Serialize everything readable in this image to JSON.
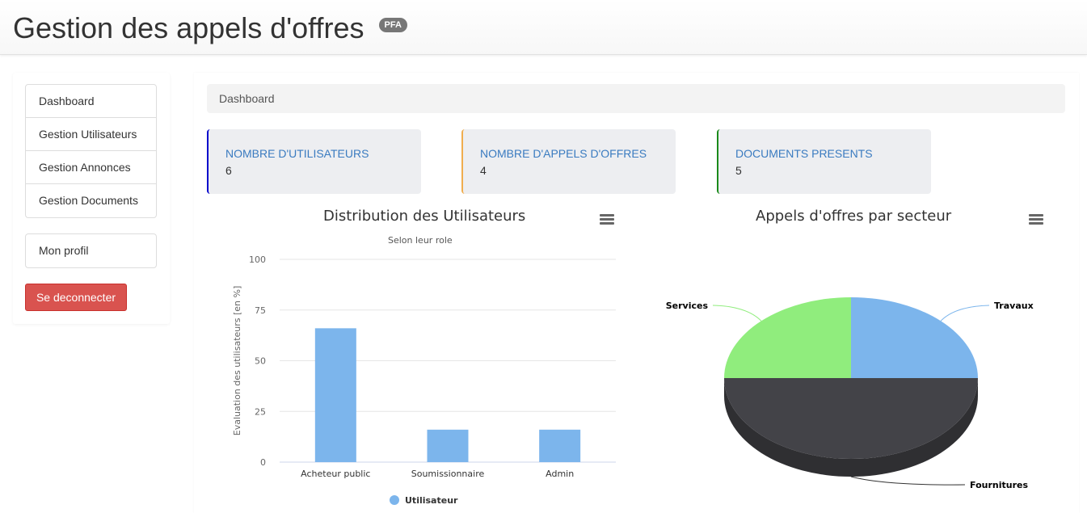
{
  "header": {
    "title": "Gestion des appels d'offres",
    "badge": "PFA"
  },
  "sidebar": {
    "items": [
      {
        "label": "Dashboard"
      },
      {
        "label": "Gestion Utilisateurs"
      },
      {
        "label": "Gestion Annonces"
      },
      {
        "label": "Gestion Documents"
      }
    ],
    "profile": "Mon profil",
    "logout": "Se deconnecter"
  },
  "breadcrumb": {
    "current": "Dashboard"
  },
  "stats": [
    {
      "label": "NOMBRE D'UTILISATEURS",
      "value": "6",
      "accent": "#0000cc"
    },
    {
      "label": "NOMBRE D'APPELS D'OFFRES",
      "value": "4",
      "accent": "#f0ad4e"
    },
    {
      "label": "DOCUMENTS PRESENTS",
      "value": "5",
      "accent": "#1a8a1a"
    }
  ],
  "chart_data": [
    {
      "type": "bar",
      "title": "Distribution des Utilisateurs",
      "subtitle": "Selon leur role",
      "ylabel": "Evaluation des utilisateurs [en %]",
      "xlabel": "",
      "ylim": [
        0,
        100
      ],
      "yticks": [
        "0",
        "25",
        "50",
        "75",
        "100"
      ],
      "categories": [
        "Acheteur public",
        "Soumissionnaire",
        "Admin"
      ],
      "series": [
        {
          "name": "Utilisateur",
          "values": [
            66,
            16,
            16
          ],
          "color": "#7cb5ec"
        }
      ],
      "grid": true,
      "legend": "bottom-center"
    },
    {
      "type": "pie",
      "title": "Appels d'offres par secteur",
      "slices": [
        {
          "label": "Travaux",
          "value": 25,
          "color": "#7cb5ec"
        },
        {
          "label": "Fournitures",
          "value": 50,
          "color": "#434348"
        },
        {
          "label": "Services",
          "value": 25,
          "color": "#90ed7d"
        }
      ],
      "style": "3d"
    }
  ]
}
